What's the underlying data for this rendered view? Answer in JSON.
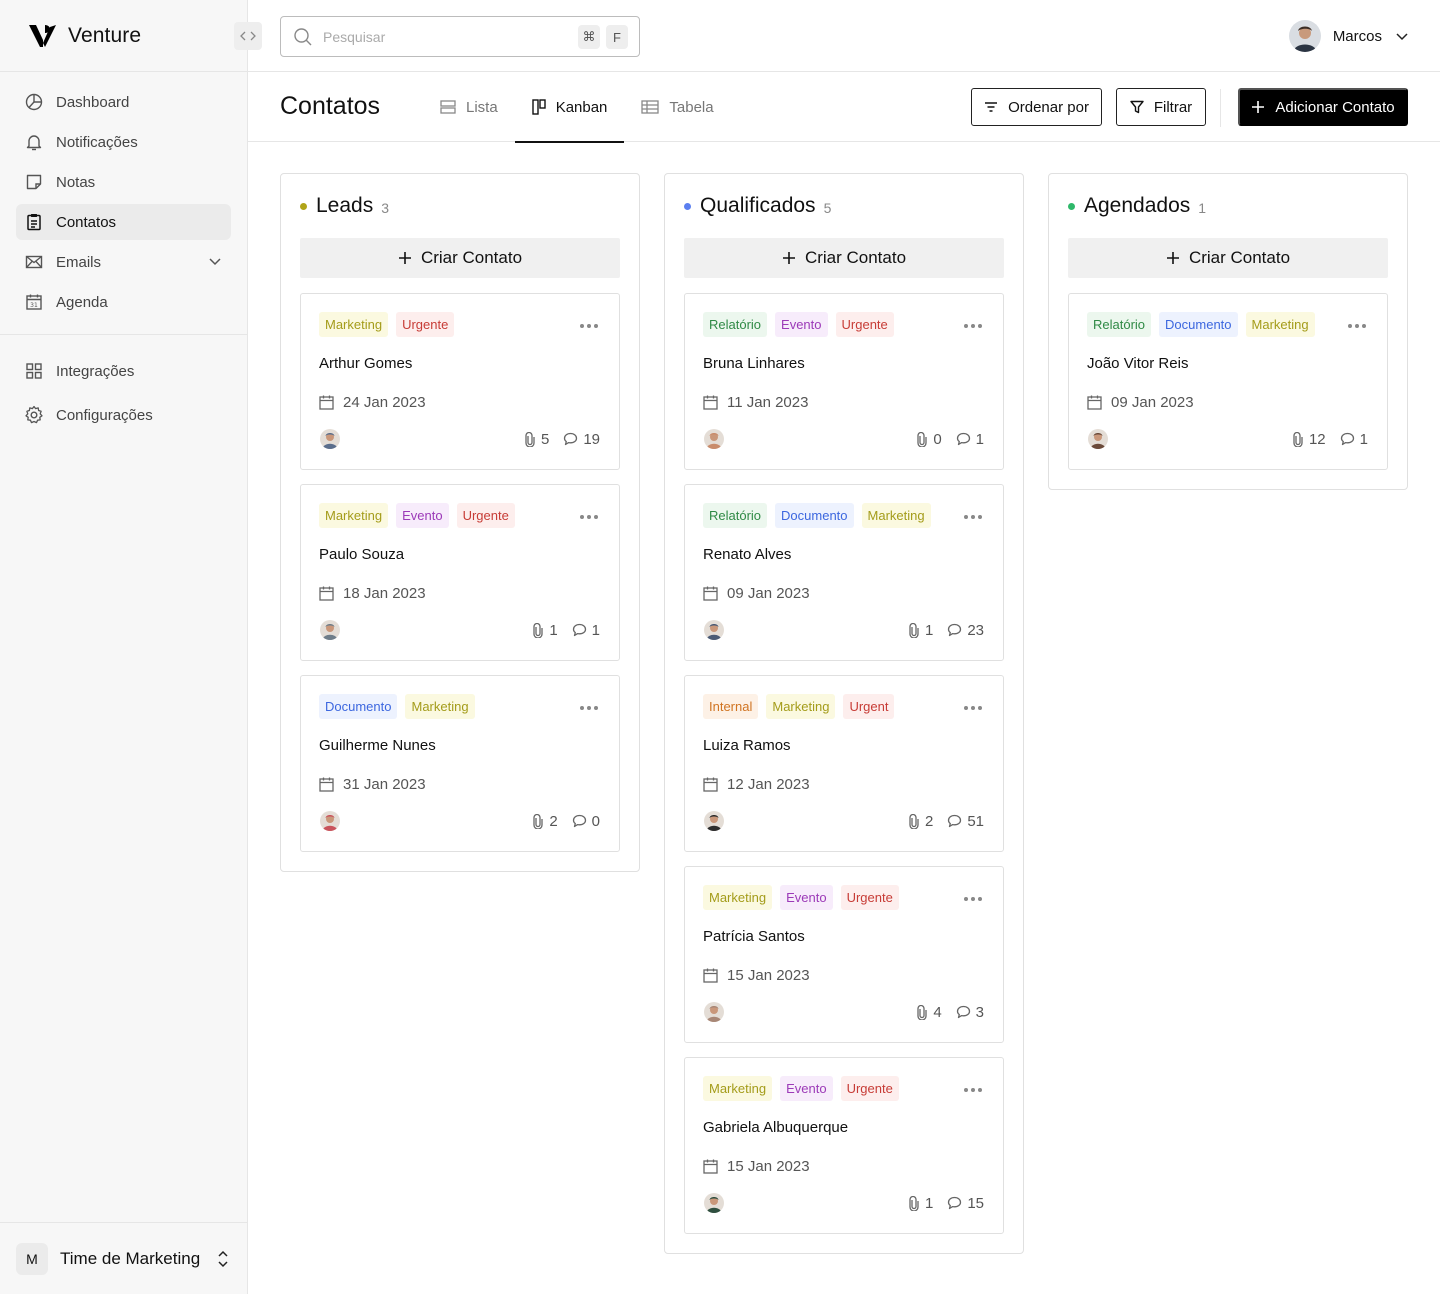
{
  "brand": {
    "name": "Venture"
  },
  "sidebar": {
    "items": [
      {
        "label": "Dashboard",
        "icon": "dashboard-icon"
      },
      {
        "label": "Notificações",
        "icon": "bell-icon"
      },
      {
        "label": "Notas",
        "icon": "note-icon"
      },
      {
        "label": "Contatos",
        "icon": "clipboard-icon",
        "active": true
      },
      {
        "label": "Emails",
        "icon": "mail-icon",
        "expandable": true
      },
      {
        "label": "Agenda",
        "icon": "calendar-icon"
      }
    ],
    "secondary": [
      {
        "label": "Integrações",
        "icon": "grid-icon"
      },
      {
        "label": "Configurações",
        "icon": "gear-icon"
      }
    ],
    "team": {
      "initial": "M",
      "name": "Time de Marketing"
    }
  },
  "header": {
    "search_placeholder": "Pesquisar",
    "shortcut": [
      "⌘",
      "F"
    ],
    "user_name": "Marcos"
  },
  "page": {
    "title": "Contatos",
    "tabs": [
      {
        "label": "Lista",
        "icon": "list-icon"
      },
      {
        "label": "Kanban",
        "icon": "kanban-icon",
        "active": true
      },
      {
        "label": "Tabela",
        "icon": "table-icon"
      }
    ],
    "sort_label": "Ordenar por",
    "filter_label": "Filtrar",
    "add_label": "Adicionar Contato"
  },
  "tag_colors": {
    "Marketing": {
      "bg": "#fbf9e0",
      "fg": "#a49c1a"
    },
    "Urgente": {
      "bg": "#fdeeed",
      "fg": "#c73c36"
    },
    "Urgent": {
      "bg": "#fdeeed",
      "fg": "#c73c36"
    },
    "Evento": {
      "bg": "#f7ecfb",
      "fg": "#9c3ab8"
    },
    "Documento": {
      "bg": "#edf2fe",
      "fg": "#3c67df"
    },
    "Relatório": {
      "bg": "#ecf7ee",
      "fg": "#2f8a45"
    },
    "Internal": {
      "bg": "#fdf1e6",
      "fg": "#d07422"
    }
  },
  "board": {
    "create_label": "Criar Contato",
    "columns": [
      {
        "title": "Leads",
        "count": "3",
        "dot_color": "#b0a418",
        "cards": [
          {
            "tags": [
              "Marketing",
              "Urgente"
            ],
            "name": "Arthur Gomes",
            "date": "24 Jan 2023",
            "attachments": "5",
            "comments": "19",
            "avatar_color": "#5b6e8c"
          },
          {
            "tags": [
              "Marketing",
              "Evento",
              "Urgente"
            ],
            "name": "Paulo Souza",
            "date": "18 Jan 2023",
            "attachments": "1",
            "comments": "1",
            "avatar_color": "#6f7d89"
          },
          {
            "tags": [
              "Documento",
              "Marketing"
            ],
            "name": "Guilherme Nunes",
            "date": "31 Jan 2023",
            "attachments": "2",
            "comments": "0",
            "avatar_color": "#c9545c"
          }
        ]
      },
      {
        "title": "Qualificados",
        "count": "5",
        "dot_color": "#5b7ff0",
        "cards": [
          {
            "tags": [
              "Relatório",
              "Evento",
              "Urgente"
            ],
            "name": "Bruna Linhares",
            "date": "11 Jan 2023",
            "attachments": "0",
            "comments": "1",
            "avatar_color": "#c98c6c"
          },
          {
            "tags": [
              "Relatório",
              "Documento",
              "Marketing"
            ],
            "name": "Renato Alves",
            "date": "09 Jan 2023",
            "attachments": "1",
            "comments": "23",
            "avatar_color": "#4a5a75"
          },
          {
            "tags": [
              "Internal",
              "Marketing",
              "Urgent"
            ],
            "name": "Luiza Ramos",
            "date": "12 Jan 2023",
            "attachments": "2",
            "comments": "51",
            "avatar_color": "#2d2d2d"
          },
          {
            "tags": [
              "Marketing",
              "Evento",
              "Urgente"
            ],
            "name": "Patrícia Santos",
            "date": "15 Jan 2023",
            "attachments": "4",
            "comments": "3",
            "avatar_color": "#a88776"
          },
          {
            "tags": [
              "Marketing",
              "Evento",
              "Urgente"
            ],
            "name": "Gabriela Albuquerque",
            "date": "15 Jan 2023",
            "attachments": "1",
            "comments": "15",
            "avatar_color": "#2f4f3f"
          }
        ]
      },
      {
        "title": "Agendados",
        "count": "1",
        "dot_color": "#2fb86a",
        "cards": [
          {
            "tags": [
              "Relatório",
              "Documento",
              "Marketing"
            ],
            "name": "João Vitor Reis",
            "date": "09 Jan 2023",
            "attachments": "12",
            "comments": "1",
            "avatar_color": "#6b4a3a"
          }
        ]
      }
    ]
  }
}
